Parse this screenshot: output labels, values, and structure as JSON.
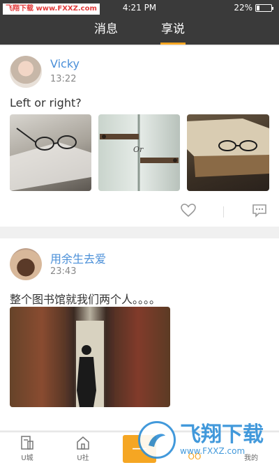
{
  "status_bar": {
    "watermark_part1": "飞翔下载",
    "watermark_part2": "www.FXXZ.com",
    "time": "4:21 PM",
    "battery_percent": "22%",
    "battery_level": 0.22
  },
  "top_nav": {
    "tabs": [
      {
        "label": "消息"
      },
      {
        "label": "享说"
      }
    ]
  },
  "posts": [
    {
      "username": "Vicky",
      "time": "13:22",
      "text": "Left or right?"
    },
    {
      "username": "用余生去爱",
      "time": "23:43",
      "text": "整个图书馆就我们两个人。。。。"
    }
  ],
  "photo2_caption": "Or",
  "bottom_nav": {
    "items": [
      {
        "label": "U城"
      },
      {
        "label": "U社"
      },
      {
        "label": "OO"
      },
      {
        "label": "我的"
      }
    ]
  },
  "watermark_bottom": {
    "big": "飞翔下载",
    "small": "www.FXXZ.com"
  },
  "colors": {
    "accent": "#f5a623",
    "username": "#4a8fd8",
    "header_bg": "#3a3a3a"
  }
}
